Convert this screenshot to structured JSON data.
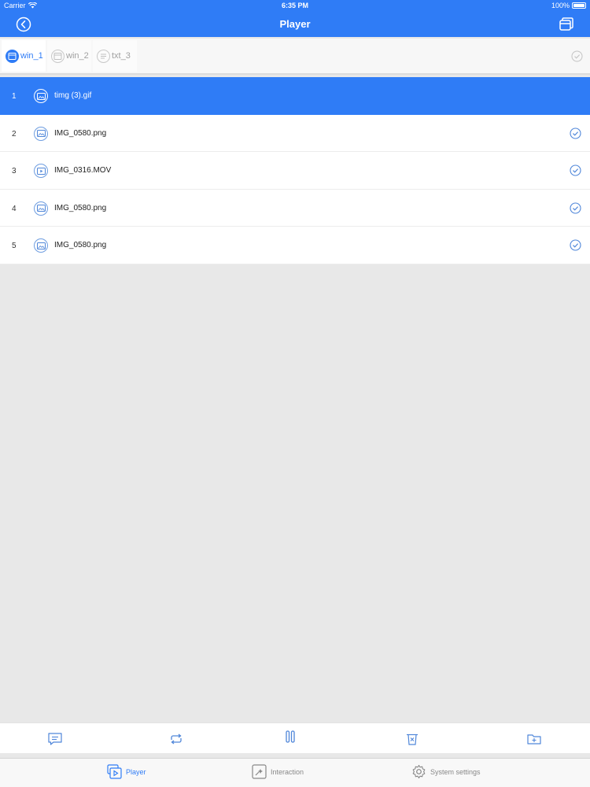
{
  "status_bar": {
    "carrier": "Carrier",
    "time": "6:35 PM",
    "battery": "100%"
  },
  "nav": {
    "title": "Player",
    "back_icon": "back-circle-icon",
    "right_icon": "windows-icon"
  },
  "window_tabs": [
    {
      "label": "win_1",
      "active": true
    },
    {
      "label": "win_2",
      "active": false
    },
    {
      "label": "txt_3",
      "active": false
    }
  ],
  "files": [
    {
      "index": "1",
      "name": "timg (3).gif",
      "type": "image",
      "selected": true,
      "checked": false
    },
    {
      "index": "2",
      "name": "IMG_0580.png",
      "type": "image",
      "selected": false,
      "checked": true
    },
    {
      "index": "3",
      "name": "IMG_0316.MOV",
      "type": "video",
      "selected": false,
      "checked": true
    },
    {
      "index": "4",
      "name": "IMG_0580.png",
      "type": "image",
      "selected": false,
      "checked": true
    },
    {
      "index": "5",
      "name": "IMG_0580.png",
      "type": "image",
      "selected": false,
      "checked": true
    }
  ],
  "toolbar": [
    "message-icon",
    "repeat-icon",
    "pause-icon",
    "delete-icon",
    "add-folder-icon"
  ],
  "tabbar": {
    "player": "Player",
    "interaction": "Interaction",
    "system_settings": "System settings"
  },
  "colors": {
    "accent": "#2f7cf6",
    "background": "#e8e8e8",
    "list_bg": "#ffffff"
  }
}
